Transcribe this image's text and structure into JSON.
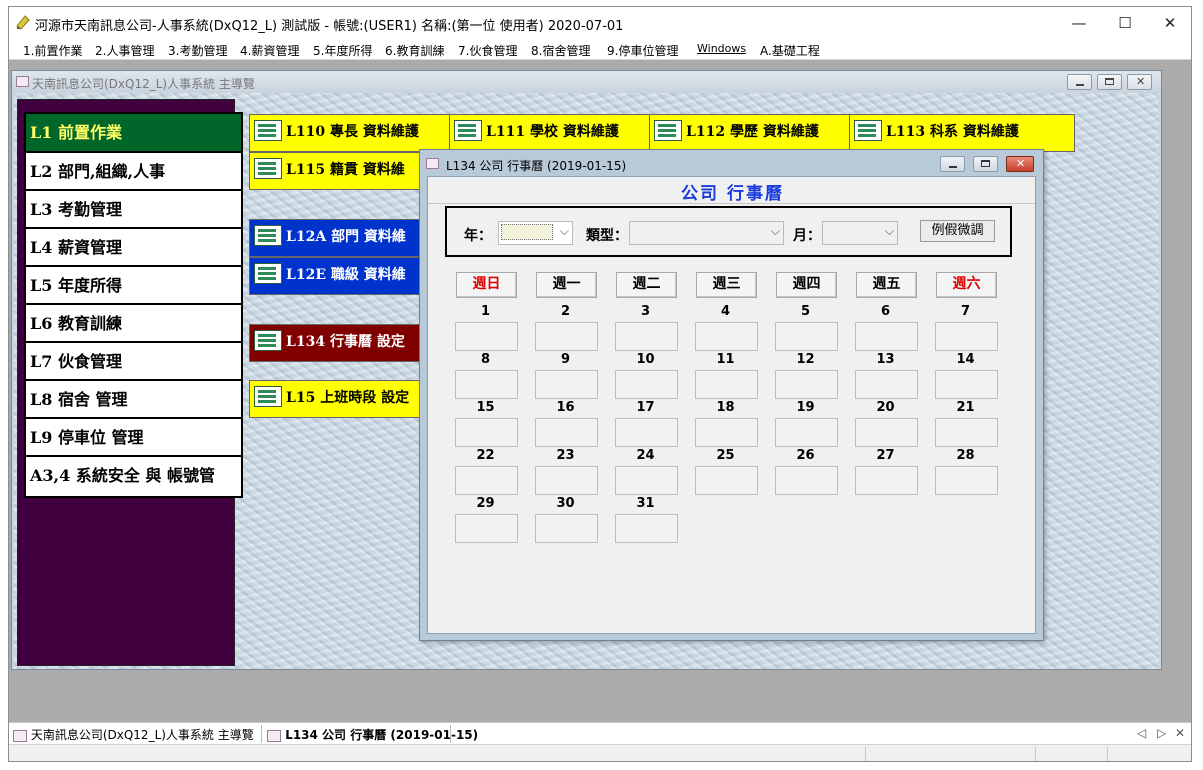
{
  "window": {
    "title": "河源市天南訊息公司-人事系統(DxQ12_L) 測試版 - 帳號:(USER1) 名稱:(第一位 使用者) 2020-07-01",
    "minimize": "—",
    "maximize": "☐",
    "close": "✕"
  },
  "menu": [
    "1.前置作業",
    "2.人事管理",
    "3.考勤管理",
    "4.薪資管理",
    "5.年度所得",
    "6.教育訓練",
    "7.伙食管理",
    "8.宿舍管理",
    "9.停車位管理",
    "Windows",
    "A.基礎工程"
  ],
  "main_window": {
    "title": "天南訊息公司(DxQ12_L)人事系統 主導覽"
  },
  "nav": [
    "L1 前置作業",
    "L2 部門,組織,人事",
    "L3 考勤管理",
    "L4 薪資管理",
    "L5 年度所得",
    "L6 教育訓練",
    "L7 伙食管理",
    "L8 宿舍 管理",
    "L9 停車位 管理",
    "A3,4 系統安全 與 帳號管"
  ],
  "tiles": [
    "L110 專長 資料維護",
    "L111 學校 資料維護",
    "L112 學歷 資料維護",
    "L113 科系 資料維護",
    "L115 籍貫 資料維",
    "L12A 部門 資料維",
    "L12E 職級 資料維",
    "L134 行事曆 設定",
    "L15 上班時段 設定"
  ],
  "dialog": {
    "title": "L134 公司 行事曆 (2019-01-15)",
    "heading": "公司 行事曆",
    "year_label": "年：",
    "year_value": "",
    "type_label": "類型：",
    "type_value": "",
    "month_label": "月：",
    "month_value": "",
    "adjust_button": "例假微調",
    "weekdays": [
      "週日",
      "週一",
      "週二",
      "週三",
      "週四",
      "週五",
      "週六"
    ],
    "weekend_color": "#e00000",
    "days": [
      "1",
      "2",
      "3",
      "4",
      "5",
      "6",
      "7",
      "8",
      "9",
      "10",
      "11",
      "12",
      "13",
      "14",
      "15",
      "16",
      "17",
      "18",
      "19",
      "20",
      "21",
      "22",
      "23",
      "24",
      "25",
      "26",
      "27",
      "28",
      "29",
      "30",
      "31"
    ]
  },
  "taskbar": {
    "items": [
      "天南訊息公司(DxQ12_L)人事系統 主導覽",
      "L134 公司 行事曆 (2019-01-15)"
    ],
    "prev": "◁",
    "next": "▷",
    "close": "✕"
  }
}
